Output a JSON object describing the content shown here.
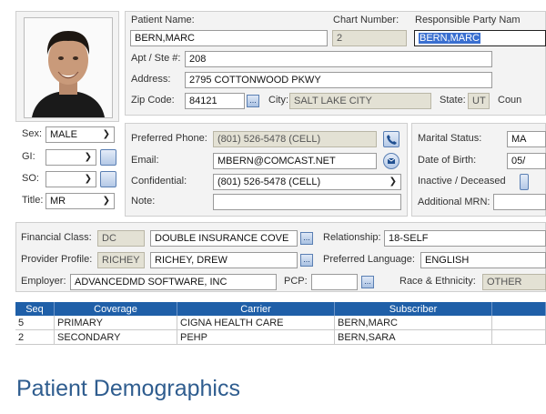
{
  "patient": {
    "name_label": "Patient Name:",
    "name_value": "BERN,MARC",
    "chart_label": "Chart Number:",
    "chart_value": "2",
    "resp_label": "Responsible Party Nam",
    "resp_value": "BERN,MARC",
    "apt_label": "Apt / Ste #:",
    "apt_value": "208",
    "address_label": "Address:",
    "address_value": "2795 COTTONWOOD PKWY",
    "zip_label": "Zip Code:",
    "zip_value": "84121",
    "city_label": "City:",
    "city_value": "SALT LAKE CITY",
    "state_label": "State:",
    "state_value": "UT",
    "county_label": "Coun"
  },
  "left": {
    "sex_label": "Sex:",
    "sex_value": "MALE",
    "gi_label": "GI:",
    "gi_value": "",
    "so_label": "SO:",
    "so_value": "",
    "title_label": "Title:",
    "title_value": "MR"
  },
  "contact": {
    "phone_label": "Preferred Phone:",
    "phone_value": "(801) 526-5478 (CELL)",
    "email_label": "Email:",
    "email_value": "MBERN@COMCAST.NET",
    "conf_label": "Confidential:",
    "conf_value": "(801) 526-5478 (CELL)",
    "note_label": "Note:",
    "note_value": ""
  },
  "status": {
    "marital_label": "Marital Status:",
    "marital_value": "MA",
    "dob_label": "Date of Birth:",
    "dob_value": "05/",
    "inactive_label": "Inactive / Deceased",
    "mrn_label": "Additional MRN:",
    "mrn_value": ""
  },
  "financial": {
    "class_label": "Financial Class:",
    "class_code": "DC",
    "class_value": "DOUBLE INSURANCE COVE",
    "relationship_label": "Relationship:",
    "relationship_value": "18-SELF",
    "provider_label": "Provider Profile:",
    "provider_code": "RICHEY",
    "provider_value": "RICHEY, DREW",
    "language_label": "Preferred Language:",
    "language_value": "ENGLISH",
    "employer_label": "Employer:",
    "employer_value": "ADVANCEDMD SOFTWARE, INC",
    "pcp_label": "PCP:",
    "pcp_value": "",
    "race_label": "Race & Ethnicity:",
    "race_value": "OTHER"
  },
  "insurance": {
    "headers": [
      "Seq",
      "Coverage",
      "Carrier",
      "Subscriber"
    ],
    "rows": [
      [
        "5",
        "PRIMARY",
        "CIGNA HEALTH CARE",
        "BERN,MARC"
      ],
      [
        "2",
        "SECONDARY",
        "PEHP",
        "BERN,SARA"
      ]
    ]
  },
  "caption": "Patient Demographics",
  "colors": {
    "header_blue": "#1f5fa8",
    "readonly_field": "#e3e1d4",
    "caption": "#2f5d8f"
  },
  "icons": {
    "phone": "phone-icon",
    "email": "email-icon",
    "chevron": "chevron-down-icon",
    "lookup": "ellipsis-lookup-icon"
  }
}
